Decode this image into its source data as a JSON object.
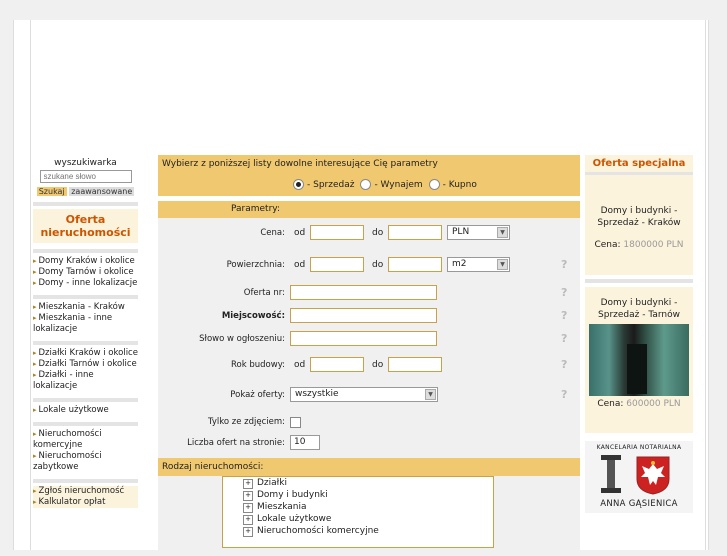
{
  "search": {
    "title": "wyszukiwarka",
    "placeholder": "szukane słowo",
    "szukaj": "Szukaj",
    "zaawansowane": "zaawansowane"
  },
  "left_menu": {
    "oferta_title": "Oferta nieruchomości",
    "group1": [
      "Domy Kraków i okolice",
      "Domy Tarnów i okolice",
      "Domy - inne lokalizacje"
    ],
    "group2": [
      "Mieszkania - Kraków",
      "Mieszkania - inne lokalizacje"
    ],
    "group3": [
      "Działki Kraków i okolice",
      "Działki Tarnów i okolice",
      "Działki - inne lokalizacje"
    ],
    "group4": [
      "Lokale użytkowe"
    ],
    "group5": [
      "Nieruchomości komercyjne",
      "Nieruchomości zabytkowe"
    ],
    "group6": [
      "Zgłoś nieruchomość",
      "Kalkulator opłat"
    ]
  },
  "form": {
    "instruction": "Wybierz z poniższej listy dowolne interesujące Cię parametry",
    "radios": [
      {
        "label": "- Sprzedaż",
        "checked": true
      },
      {
        "label": "- Wynajem",
        "checked": false
      },
      {
        "label": "- Kupno",
        "checked": false
      }
    ],
    "params_header": "Parametry:",
    "cena_label": "Cena:",
    "od": "od",
    "do": "do",
    "currency": "PLN",
    "powierzchnia_label": "Powierzchnia:",
    "unit": "m2",
    "oferta_nr_label": "Oferta nr:",
    "miejscowosc_label": "Miejscowość:",
    "slowo_label": "Słowo w ogłoszeniu:",
    "rok_label": "Rok budowy:",
    "pokaz_label": "Pokaż oferty:",
    "pokaz_value": "wszystkie",
    "zdjecie_label": "Tylko ze zdjęciem:",
    "liczba_label": "Liczba ofert na stronie:",
    "liczba_value": "10",
    "help": "?",
    "rodzaj_header": "Rodzaj nieruchomości:",
    "tree": [
      "Działki",
      "Domy i budynki",
      "Mieszkania",
      "Lokale użytkowe",
      "Nieruchomości komercyjne"
    ],
    "tree_toggle": "+"
  },
  "special": {
    "title": "Oferta specjalna",
    "offer1_title": "Domy i budynki - Sprzedaż - Kraków",
    "offer1_price_label": "Cena:",
    "offer1_price": "1800000 PLN",
    "offer2_title": "Domy i budynki - Sprzedaż - Tarnów",
    "offer2_price_label": "Cena:",
    "offer2_price": "600000 PLN"
  },
  "notary": {
    "top": "KANCELARIA NOTARIALNA",
    "name": "ANNA GĄSIENICA"
  }
}
